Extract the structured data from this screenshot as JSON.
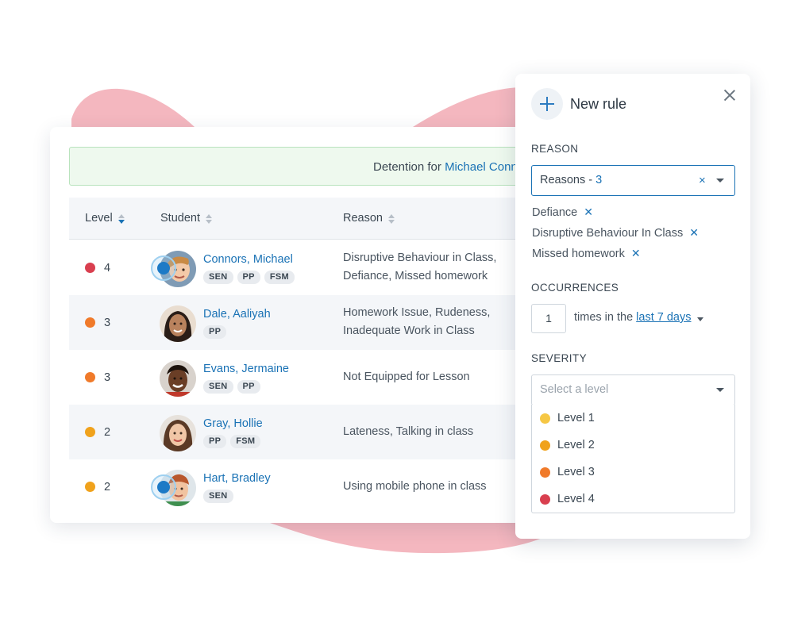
{
  "colors": {
    "level_1": "#f6c744",
    "level_2": "#f0a21c",
    "level_3": "#f07a2a",
    "level_4": "#d93f4f",
    "link": "#1a72b5",
    "blob": "#f4b7bf"
  },
  "banner": {
    "prefix": "Detention for ",
    "student_link": "Michael Conn"
  },
  "table": {
    "headers": {
      "level": "Level",
      "student": "Student",
      "reason": "Reason"
    },
    "rows": [
      {
        "level": "4",
        "level_color": "level_4",
        "name": "Connors, Michael",
        "tags": [
          "SEN",
          "PP",
          "FSM"
        ],
        "reason_line1": "Disruptive Behaviour in Class,",
        "reason_line2": "Defiance, Missed homework"
      },
      {
        "level": "3",
        "level_color": "level_3",
        "name": "Dale, Aaliyah",
        "tags": [
          "PP"
        ],
        "reason_line1": "Homework Issue, Rudeness,",
        "reason_line2": "Inadequate Work in Class"
      },
      {
        "level": "3",
        "level_color": "level_3",
        "name": "Evans, Jermaine",
        "tags": [
          "SEN",
          "PP"
        ],
        "reason_line1": "Not Equipped for Lesson",
        "reason_line2": ""
      },
      {
        "level": "2",
        "level_color": "level_2",
        "name": "Gray, Hollie",
        "tags": [
          "PP",
          "FSM"
        ],
        "reason_line1": "Lateness, Talking in class",
        "reason_line2": ""
      },
      {
        "level": "2",
        "level_color": "level_2",
        "name": "Hart, Bradley",
        "tags": [
          "SEN"
        ],
        "reason_line1": "Using mobile phone in class",
        "reason_line2": ""
      }
    ]
  },
  "panel": {
    "title": "New rule",
    "reason_label": "REASON",
    "reasons_select": {
      "prefix": "Reasons - ",
      "count": "3",
      "clear": "×"
    },
    "selected_reasons": [
      "Defiance",
      "Disruptive Behaviour In Class",
      "Missed homework"
    ],
    "occurrences_label": "OCCURRENCES",
    "occurrences_value": "1",
    "times_text": "times in the ",
    "period": "last 7 days",
    "severity_label": "SEVERITY",
    "severity_placeholder": "Select a level",
    "levels": [
      "Level 1",
      "Level 2",
      "Level 3",
      "Level 4"
    ]
  }
}
